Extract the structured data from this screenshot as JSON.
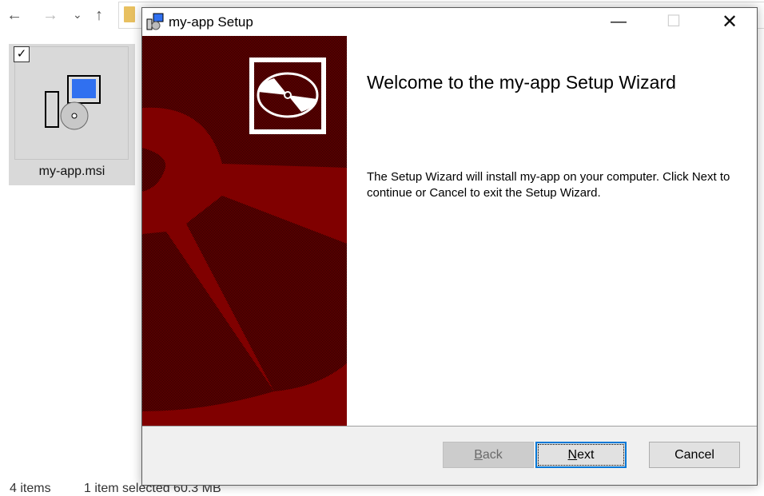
{
  "explorer": {
    "nav": {
      "back": "←",
      "forward": "→",
      "recent": "⌄",
      "up": "↑"
    },
    "file": {
      "name": "my-app.msi",
      "selected": true
    },
    "status": {
      "items": "4 items",
      "selection": "1 item selected  60.3 MB"
    }
  },
  "dialog": {
    "title": "my-app Setup",
    "heading": "Welcome to the my-app Setup Wizard",
    "body": "The Setup Wizard will install my-app on your computer. Click Next to continue or Cancel to exit the Setup Wizard.",
    "buttons": {
      "back": {
        "label": "Back",
        "mnemonic": "B",
        "rest": "ack",
        "enabled": false
      },
      "next": {
        "label": "Next",
        "mnemonic": "N",
        "rest": "ext",
        "enabled": true
      },
      "cancel": {
        "label": "Cancel"
      }
    },
    "colors": {
      "banner_dark": "#3a0000",
      "banner_red": "#800000",
      "accent": "#0078d7"
    }
  }
}
